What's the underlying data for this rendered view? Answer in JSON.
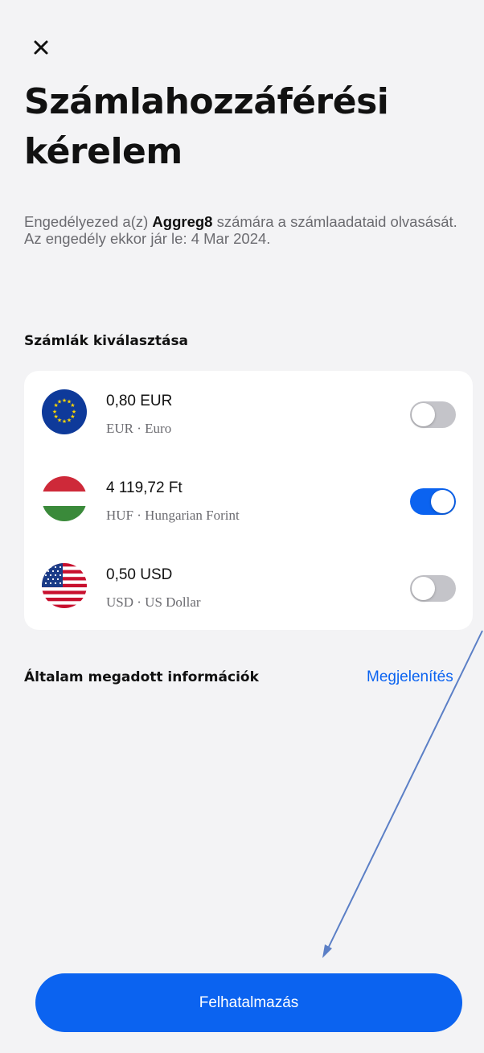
{
  "close": {
    "icon": "close-icon"
  },
  "title": "Számlahozzáférési kérelem",
  "description": {
    "before": "Engedélyezed a(z) ",
    "app_name": "Aggreg8",
    "after": " számára a számlaadataid olvasását. Az engedély ekkor jár le: 4 Mar 2024."
  },
  "accounts_section": {
    "heading": "Számlák kiválasztása",
    "items": [
      {
        "flag": "eu-flag-icon",
        "amount": "0,80 EUR",
        "subtitle": "EUR · Euro",
        "enabled": false
      },
      {
        "flag": "hungary-flag-icon",
        "amount": "4 119,72 Ft",
        "subtitle": "HUF · Hungarian Forint",
        "enabled": true
      },
      {
        "flag": "usa-flag-icon",
        "amount": "0,50 USD",
        "subtitle": "USD · US Dollar",
        "enabled": false
      }
    ]
  },
  "info_section": {
    "heading": "Általam megadott információk",
    "link": "Megjelenítés"
  },
  "primary_button": "Felhatalmazás",
  "colors": {
    "accent": "#0b63f0",
    "background": "#f3f3f5",
    "card": "#ffffff",
    "toggle_off": "#c4c4c9",
    "annotation_arrow": "#5b7fc6"
  }
}
